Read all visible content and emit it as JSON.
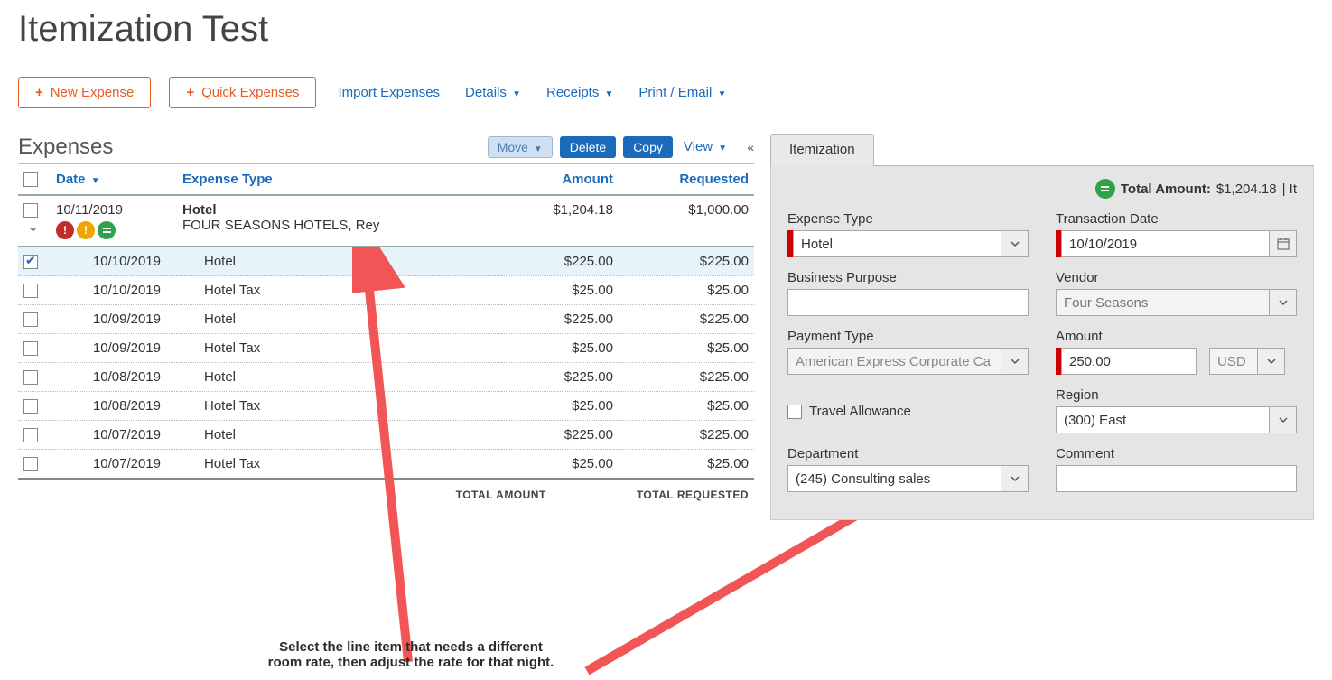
{
  "page": {
    "title": "Itemization Test"
  },
  "toolbar": {
    "new_expense": "New Expense",
    "quick_expenses": "Quick Expenses",
    "import_expenses": "Import Expenses",
    "details": "Details",
    "receipts": "Receipts",
    "print_email": "Print / Email"
  },
  "expenses": {
    "section_title": "Expenses",
    "actions": {
      "move": "Move",
      "delete": "Delete",
      "copy": "Copy",
      "view": "View"
    },
    "columns": {
      "date": "Date",
      "expense_type": "Expense Type",
      "amount": "Amount",
      "requested": "Requested"
    },
    "group": {
      "date": "10/11/2019",
      "type": "Hotel",
      "vendor": "FOUR SEASONS HOTELS, Rey",
      "amount": "$1,204.18",
      "requested": "$1,000.00"
    },
    "rows": [
      {
        "date": "10/10/2019",
        "type": "Hotel",
        "amount": "$225.00",
        "requested": "$225.00",
        "selected": true
      },
      {
        "date": "10/10/2019",
        "type": "Hotel Tax",
        "amount": "$25.00",
        "requested": "$25.00",
        "selected": false
      },
      {
        "date": "10/09/2019",
        "type": "Hotel",
        "amount": "$225.00",
        "requested": "$225.00",
        "selected": false
      },
      {
        "date": "10/09/2019",
        "type": "Hotel Tax",
        "amount": "$25.00",
        "requested": "$25.00",
        "selected": false
      },
      {
        "date": "10/08/2019",
        "type": "Hotel",
        "amount": "$225.00",
        "requested": "$225.00",
        "selected": false
      },
      {
        "date": "10/08/2019",
        "type": "Hotel Tax",
        "amount": "$25.00",
        "requested": "$25.00",
        "selected": false
      },
      {
        "date": "10/07/2019",
        "type": "Hotel",
        "amount": "$225.00",
        "requested": "$225.00",
        "selected": false
      },
      {
        "date": "10/07/2019",
        "type": "Hotel Tax",
        "amount": "$25.00",
        "requested": "$25.00",
        "selected": false
      }
    ],
    "totals": {
      "amount_label": "TOTAL AMOUNT",
      "requested_label": "TOTAL REQUESTED"
    }
  },
  "itemization": {
    "tab_label": "Itemization",
    "summary": {
      "label": "Total Amount:",
      "amount": "$1,204.18",
      "suffix": "| It"
    },
    "fields": {
      "expense_type": {
        "label": "Expense Type",
        "value": "Hotel"
      },
      "transaction_date": {
        "label": "Transaction Date",
        "value": "10/10/2019"
      },
      "business_purpose": {
        "label": "Business Purpose",
        "value": ""
      },
      "vendor": {
        "label": "Vendor",
        "placeholder": "Four Seasons"
      },
      "payment_type": {
        "label": "Payment Type",
        "value": "American Express Corporate Ca"
      },
      "amount": {
        "label": "Amount",
        "value": "250.00",
        "currency": "USD"
      },
      "travel_allowance": {
        "label": "Travel Allowance"
      },
      "region": {
        "label": "Region",
        "value": "(300) East"
      },
      "department": {
        "label": "Department",
        "value": "(245) Consulting sales"
      },
      "comment": {
        "label": "Comment",
        "value": ""
      }
    }
  },
  "annotation": {
    "line1": "Select the line item that needs a different",
    "line2": "room rate, then adjust the rate for that night."
  }
}
